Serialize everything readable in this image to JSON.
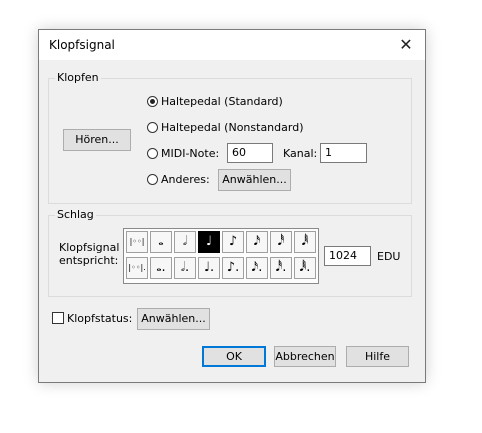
{
  "dialog": {
    "title": "Klopfsignal"
  },
  "klopfen": {
    "label": "Klopfen",
    "hoeren": "Hören...",
    "opt1": "Haltepedal (Standard)",
    "opt2": "Haltepedal (Nonstandard)",
    "opt3": "MIDI-Note:",
    "midi_note": "60",
    "kanal_label": "Kanal:",
    "kanal": "1",
    "opt4": "Anderes:",
    "anderes_btn": "Anwählen..."
  },
  "schlag": {
    "label": "Schlag",
    "desc1": "Klopfsignal",
    "desc2": "entspricht:",
    "row1": [
      "|◦◦|",
      "𝅝",
      "𝅗𝅥",
      "♩",
      "♪",
      "𝅘𝅥𝅯",
      "𝅘𝅥𝅰",
      "𝅘𝅥𝅱"
    ],
    "row2": [
      "|◦◦|.",
      "𝅝.",
      "𝅗𝅥.",
      "♩.",
      "♪.",
      "𝅘𝅥𝅯.",
      "𝅘𝅥𝅰.",
      "𝅘𝅥𝅱."
    ],
    "selected_index": 3,
    "edu_value": "1024",
    "edu_label": "EDU"
  },
  "status": {
    "label": "Klopfstatus:",
    "btn": "Anwählen..."
  },
  "footer": {
    "ok": "OK",
    "cancel": "Abbrechen",
    "help": "Hilfe"
  }
}
